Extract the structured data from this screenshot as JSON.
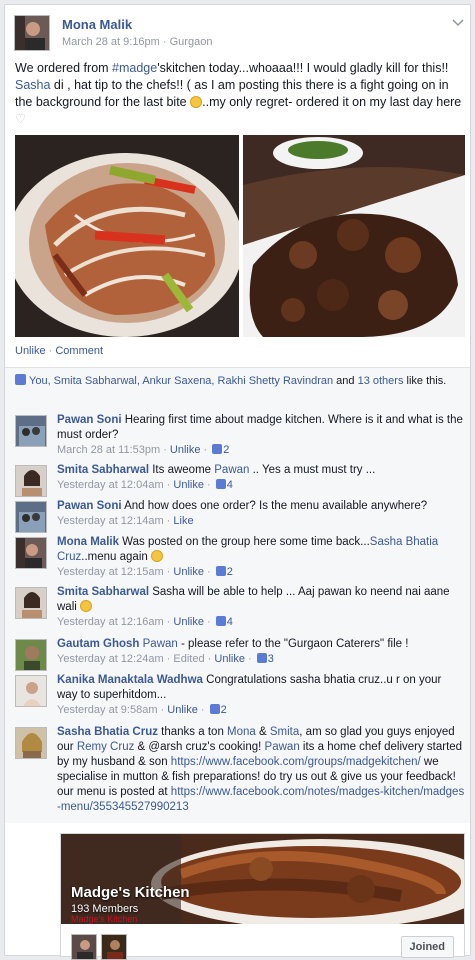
{
  "post": {
    "author": "Mona Malik",
    "date": "March 28 at 9:16pm",
    "separator": " · ",
    "location": "Gurgaon",
    "text_parts": {
      "t1": "We ordered from ",
      "hashtag": "#madge",
      "t2": "'skitchen today...whoaaa!!! I would gladly kill for this!! ",
      "mention": "Sasha",
      "t3": " di , hat tip to the chefs!! ( as I am posting this there is a fight going on in the background for the last bite ",
      "t4": "..my only regret- ordered it on my last day here "
    },
    "actions": {
      "unlike": "Unlike",
      "dot": " · ",
      "comment": "Comment"
    }
  },
  "likes": {
    "names": "You, Smita Sabharwal, Ankur Saxena, Rakhi Shetty Ravindran",
    "and": " and ",
    "others": "13 others",
    "tail": " like this."
  },
  "comments": [
    {
      "name": "Pawan Soni",
      "text": " Hearing first time about madge kitchen. Where is it and what is the must order?",
      "time": "March 28 at 11:53pm",
      "unlike": "Unlike",
      "likes": "2"
    },
    {
      "name": "Smita Sabharwal",
      "text": " Its aweome ",
      "mention": "Pawan",
      "text2": " .. Yes a must must try ...",
      "time": "Yesterday at 12:04am",
      "unlike": "Unlike",
      "likes": "4"
    },
    {
      "name": "Pawan Soni",
      "text": " And how does one order? Is the menu available anywhere?",
      "time": "Yesterday at 12:14am",
      "like": "Like"
    },
    {
      "name": "Mona Malik",
      "text": " Was posted on the group here some time back...",
      "mention": "Sasha Bhatia Cruz",
      "text2": "..menu again ",
      "time": "Yesterday at 12:15am",
      "unlike": "Unlike",
      "likes": "2"
    },
    {
      "name": "Smita Sabharwal",
      "text": " Sasha will be able to help ... Aaj pawan ko neend nai aane wali ",
      "time": "Yesterday at 12:16am",
      "unlike": "Unlike",
      "likes": "4"
    },
    {
      "name": "Gautam Ghosh",
      "mention": " Pawan",
      "text": " - please refer to the \"Gurgaon Caterers\" file !",
      "time": "Yesterday at 12:24am",
      "edited": "Edited",
      "unlike": "Unlike",
      "likes": "3"
    },
    {
      "name": "Kanika Manaktala Wadhwa",
      "text": " Congratulations sasha bhatia cruz..u r on your way to superhitdom...",
      "time": "Yesterday at 9:58am",
      "unlike": "Unlike",
      "likes": "2"
    },
    {
      "name": "Sasha Bhatia Cruz",
      "text": " thanks a ton ",
      "m1": "Mona",
      "t2": " & ",
      "m2": "Smita",
      "t3": ", am so glad you guys enjoyed our ",
      "m3": "Remy Cruz",
      "t4": " & @arsh cruz's cooking! ",
      "m4": "Pawan",
      "t5": " its a home chef delivery started by my husband & son ",
      "url1": "https://www.facebook.com/groups/madgekitchen/",
      "t6": " we specialise in mutton & fish preparations! do try us out & give us your feedback! our menu is posted at ",
      "url2": "https://www.facebook.com/notes/madges-kitchen/madges-menu/355345527990213"
    }
  ],
  "group": {
    "title": "Madge's Kitchen",
    "members": "193 Members",
    "watermark": "Madge's Kitchen",
    "joined": "Joined"
  },
  "colors": {
    "link": "#3b5998",
    "meta": "#9197a3",
    "background": "#e9ebee"
  }
}
